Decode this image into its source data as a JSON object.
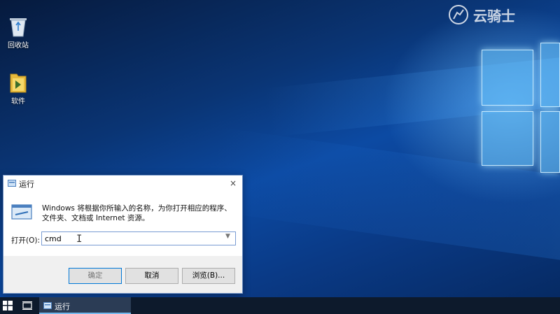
{
  "desktop": {
    "icons": [
      {
        "label": "回收站",
        "icon": "recycle-bin-icon"
      },
      {
        "label": "软件",
        "icon": "folder-icon"
      }
    ],
    "watermark": "云骑士"
  },
  "run_dialog": {
    "title": "运行",
    "close_glyph": "×",
    "description": "Windows 将根据你所输入的名称，为你打开相应的程序、文件夹、文档或 Internet 资源。",
    "open_label": "打开(O):",
    "input_value": "cmd",
    "buttons": {
      "ok": "确定",
      "cancel": "取消",
      "browse": "浏览(B)..."
    }
  },
  "taskbar": {
    "items": [
      {
        "label": "运行",
        "icon": "run-icon"
      }
    ]
  },
  "colors": {
    "accent": "#0078d7",
    "taskbar": "#0d1a2c"
  }
}
